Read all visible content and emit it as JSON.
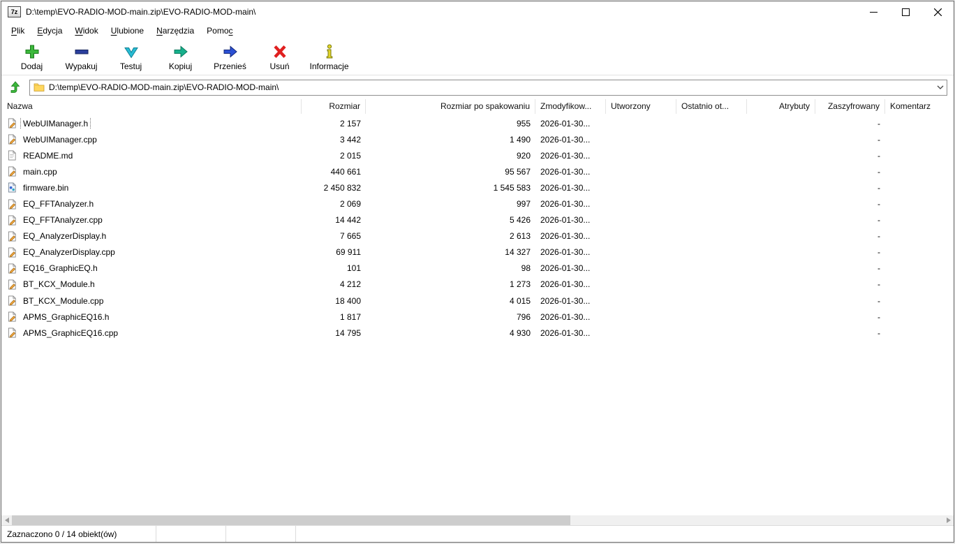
{
  "window": {
    "app_icon_label": "7z",
    "title": "D:\\temp\\EVO-RADIO-MOD-main.zip\\EVO-RADIO-MOD-main\\"
  },
  "menu": [
    {
      "id": "plik",
      "label": "Plik",
      "accel": 0
    },
    {
      "id": "edycja",
      "label": "Edycja",
      "accel": 0
    },
    {
      "id": "widok",
      "label": "Widok",
      "accel": 0
    },
    {
      "id": "ulubione",
      "label": "Ulubione",
      "accel": 0
    },
    {
      "id": "narzedzia",
      "label": "Narzędzia",
      "accel": 0
    },
    {
      "id": "pomoc",
      "label": "Pomoc",
      "accel": 4
    }
  ],
  "toolbar": [
    {
      "id": "add",
      "label": "Dodaj",
      "icon": "add-plus-icon"
    },
    {
      "id": "extract",
      "label": "Wypakuj",
      "icon": "extract-minus-icon"
    },
    {
      "id": "test",
      "label": "Testuj",
      "icon": "test-check-icon"
    },
    {
      "id": "copy",
      "label": "Kopiuj",
      "icon": "copy-arrow-icon"
    },
    {
      "id": "move",
      "label": "Przenieś",
      "icon": "move-arrow-icon"
    },
    {
      "id": "delete",
      "label": "Usuń",
      "icon": "delete-x-icon"
    },
    {
      "id": "info",
      "label": "Informacje",
      "icon": "info-icon"
    }
  ],
  "address": {
    "path": "D:\\temp\\EVO-RADIO-MOD-main.zip\\EVO-RADIO-MOD-main\\"
  },
  "columns": [
    {
      "id": "name",
      "label": "Nazwa"
    },
    {
      "id": "size",
      "label": "Rozmiar"
    },
    {
      "id": "packed",
      "label": "Rozmiar po spakowaniu"
    },
    {
      "id": "modified",
      "label": "Zmodyfikow..."
    },
    {
      "id": "created",
      "label": "Utworzony"
    },
    {
      "id": "accessed",
      "label": "Ostatnio ot..."
    },
    {
      "id": "attrs",
      "label": "Atrybuty"
    },
    {
      "id": "encrypted",
      "label": "Zaszyfrowany"
    },
    {
      "id": "comment",
      "label": "Komentarz"
    }
  ],
  "files": [
    {
      "name": "WebUIManager.h",
      "icon": "file-edit-icon",
      "size": "2 157",
      "packed": "955",
      "modified": "2026-01-30...",
      "created": "",
      "accessed": "",
      "attrs": "",
      "encrypted": "-",
      "comment": "",
      "focused": true
    },
    {
      "name": "WebUIManager.cpp",
      "icon": "file-edit-icon",
      "size": "3 442",
      "packed": "1 490",
      "modified": "2026-01-30...",
      "created": "",
      "accessed": "",
      "attrs": "",
      "encrypted": "-",
      "comment": "",
      "focused": false
    },
    {
      "name": "README.md",
      "icon": "file-icon",
      "size": "2 015",
      "packed": "920",
      "modified": "2026-01-30...",
      "created": "",
      "accessed": "",
      "attrs": "",
      "encrypted": "-",
      "comment": "",
      "focused": false
    },
    {
      "name": "main.cpp",
      "icon": "file-edit-icon",
      "size": "440 661",
      "packed": "95 567",
      "modified": "2026-01-30...",
      "created": "",
      "accessed": "",
      "attrs": "",
      "encrypted": "-",
      "comment": "",
      "focused": false
    },
    {
      "name": "firmware.bin",
      "icon": "binary-file-icon",
      "size": "2 450 832",
      "packed": "1 545 583",
      "modified": "2026-01-30...",
      "created": "",
      "accessed": "",
      "attrs": "",
      "encrypted": "-",
      "comment": "",
      "focused": false
    },
    {
      "name": "EQ_FFTAnalyzer.h",
      "icon": "file-edit-icon",
      "size": "2 069",
      "packed": "997",
      "modified": "2026-01-30...",
      "created": "",
      "accessed": "",
      "attrs": "",
      "encrypted": "-",
      "comment": "",
      "focused": false
    },
    {
      "name": "EQ_FFTAnalyzer.cpp",
      "icon": "file-edit-icon",
      "size": "14 442",
      "packed": "5 426",
      "modified": "2026-01-30...",
      "created": "",
      "accessed": "",
      "attrs": "",
      "encrypted": "-",
      "comment": "",
      "focused": false
    },
    {
      "name": "EQ_AnalyzerDisplay.h",
      "icon": "file-edit-icon",
      "size": "7 665",
      "packed": "2 613",
      "modified": "2026-01-30...",
      "created": "",
      "accessed": "",
      "attrs": "",
      "encrypted": "-",
      "comment": "",
      "focused": false
    },
    {
      "name": "EQ_AnalyzerDisplay.cpp",
      "icon": "file-edit-icon",
      "size": "69 911",
      "packed": "14 327",
      "modified": "2026-01-30...",
      "created": "",
      "accessed": "",
      "attrs": "",
      "encrypted": "-",
      "comment": "",
      "focused": false
    },
    {
      "name": "EQ16_GraphicEQ.h",
      "icon": "file-edit-icon",
      "size": "101",
      "packed": "98",
      "modified": "2026-01-30...",
      "created": "",
      "accessed": "",
      "attrs": "",
      "encrypted": "-",
      "comment": "",
      "focused": false
    },
    {
      "name": "BT_KCX_Module.h",
      "icon": "file-edit-icon",
      "size": "4 212",
      "packed": "1 273",
      "modified": "2026-01-30...",
      "created": "",
      "accessed": "",
      "attrs": "",
      "encrypted": "-",
      "comment": "",
      "focused": false
    },
    {
      "name": "BT_KCX_Module.cpp",
      "icon": "file-edit-icon",
      "size": "18 400",
      "packed": "4 015",
      "modified": "2026-01-30...",
      "created": "",
      "accessed": "",
      "attrs": "",
      "encrypted": "-",
      "comment": "",
      "focused": false
    },
    {
      "name": "APMS_GraphicEQ16.h",
      "icon": "file-edit-icon",
      "size": "1 817",
      "packed": "796",
      "modified": "2026-01-30...",
      "created": "",
      "accessed": "",
      "attrs": "",
      "encrypted": "-",
      "comment": "",
      "focused": false
    },
    {
      "name": "APMS_GraphicEQ16.cpp",
      "icon": "file-edit-icon",
      "size": "14 795",
      "packed": "4 930",
      "modified": "2026-01-30...",
      "created": "",
      "accessed": "",
      "attrs": "",
      "encrypted": "-",
      "comment": "",
      "focused": false
    }
  ],
  "statusbar": {
    "selection": "Zaznaczono 0 / 14 obiekt(ów)"
  }
}
